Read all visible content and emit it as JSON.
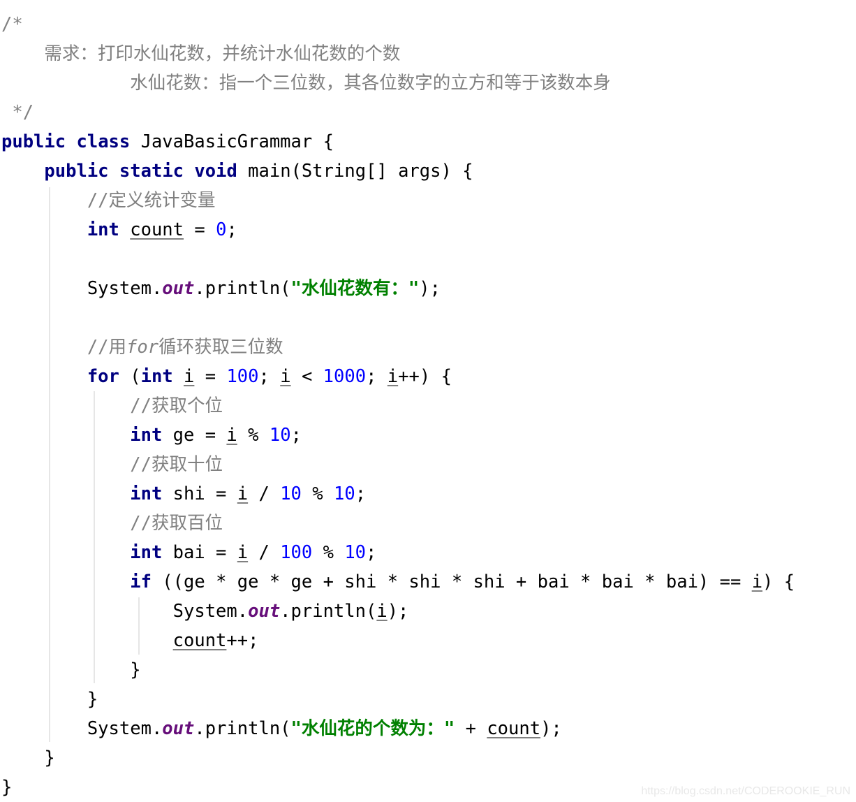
{
  "code": {
    "comment_open": "/*",
    "comment_line1": "    需求：打印水仙花数，并统计水仙花数的个数",
    "comment_line2": "            水仙花数：指一个三位数，其各位数字的立方和等于该数本身",
    "comment_close": " */",
    "kw_public": "public",
    "kw_class": "class",
    "kw_static": "static",
    "kw_void": "void",
    "kw_int": "int",
    "kw_for": "for",
    "kw_if": "if",
    "class_name": " JavaBasicGrammar {",
    "main_sig": " main(String[] args) {",
    "cmt_define": "//定义统计变量",
    "var_count": "count",
    "var_i": "i",
    "num_0": "0",
    "num_10": "10",
    "num_100": "100",
    "num_1000": "1000",
    "system": "System.",
    "out": "out",
    "println": ".println(",
    "str_header": "\"水仙花数有：\"",
    "cmt_for_prefix": "//用",
    "cmt_for_kw": "for",
    "cmt_for_suffix": "循环获取三位数",
    "cmt_ge": "//获取个位",
    "cmt_shi": "//获取十位",
    "cmt_bai": "//获取百位",
    "if_expr": " ((ge * ge * ge + shi * shi * shi + bai * bai * bai) == ",
    "str_result": "\"水仙花的个数为：\""
  },
  "watermark": "https://blog.csdn.net/CODEROOKIE_RUN"
}
